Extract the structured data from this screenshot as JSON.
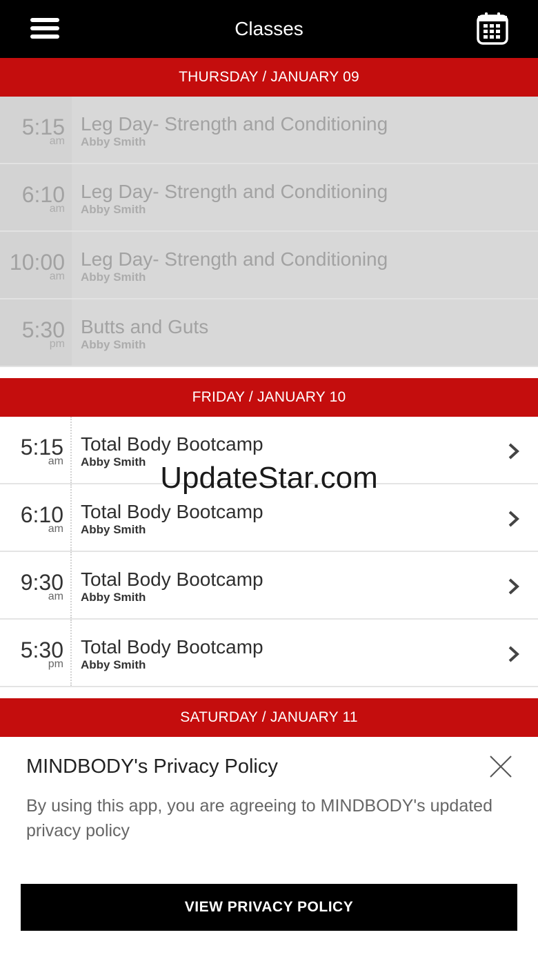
{
  "header": {
    "title": "Classes",
    "menu_icon": "hamburger-menu-icon",
    "calendar_icon": "calendar-icon"
  },
  "colors": {
    "header_bg": "#000000",
    "day_header_bg": "#c40d0d",
    "past_row_bg": "#d8d8d8",
    "button_bg": "#000000"
  },
  "days": [
    {
      "label": "THURSDAY / JANUARY 09",
      "past": true,
      "classes": [
        {
          "time": "5:15",
          "ampm": "am",
          "name": "Leg Day- Strength and Conditioning",
          "instructor": "Abby Smith"
        },
        {
          "time": "6:10",
          "ampm": "am",
          "name": "Leg Day- Strength and Conditioning",
          "instructor": "Abby Smith"
        },
        {
          "time": "10:00",
          "ampm": "am",
          "name": "Leg Day- Strength and Conditioning",
          "instructor": "Abby Smith"
        },
        {
          "time": "5:30",
          "ampm": "pm",
          "name": "Butts and Guts",
          "instructor": "Abby Smith"
        }
      ]
    },
    {
      "label": "FRIDAY / JANUARY 10",
      "past": false,
      "classes": [
        {
          "time": "5:15",
          "ampm": "am",
          "name": "Total Body Bootcamp",
          "instructor": "Abby Smith"
        },
        {
          "time": "6:10",
          "ampm": "am",
          "name": "Total Body Bootcamp",
          "instructor": "Abby Smith"
        },
        {
          "time": "9:30",
          "ampm": "am",
          "name": "Total Body Bootcamp",
          "instructor": "Abby Smith"
        },
        {
          "time": "5:30",
          "ampm": "pm",
          "name": "Total Body Bootcamp",
          "instructor": "Abby Smith"
        }
      ]
    },
    {
      "label": "SATURDAY / JANUARY 11",
      "past": false,
      "classes": []
    }
  ],
  "watermark": "UpdateStar.com",
  "privacy": {
    "title": "MINDBODY's Privacy Policy",
    "body": "By using this app, you are agreeing to MINDBODY's updated privacy policy",
    "button_label": "VIEW PRIVACY POLICY",
    "close_icon": "close-icon"
  }
}
